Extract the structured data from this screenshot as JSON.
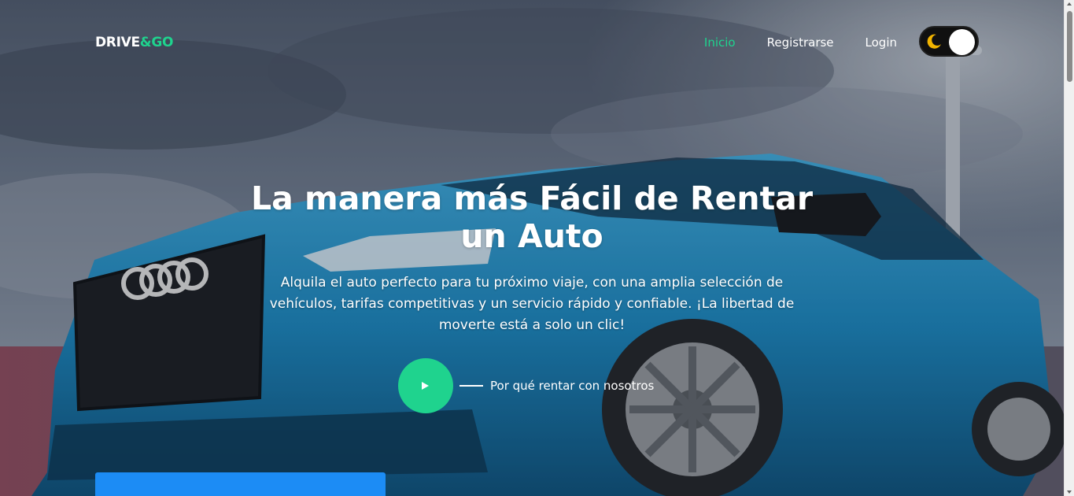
{
  "navbar": {
    "logo_main": "DRIVE",
    "logo_accent": "&GO",
    "links": [
      {
        "label": "Inicio",
        "active": true
      },
      {
        "label": "Registrarse",
        "active": false
      },
      {
        "label": "Login",
        "active": false
      }
    ],
    "theme_toggle": {
      "icon": "moon-icon",
      "mode": "dark"
    }
  },
  "hero": {
    "title": "La manera más Fácil de Rentar un Auto",
    "subtitle": "Alquila el auto perfecto para tu próximo viaje, con una amplia selección de vehículos, tarifas competitivas y un servicio rápido y confiable. ¡La libertad de moverte está a solo un clic!",
    "cta_label": "Por qué rentar con nosotros",
    "play_icon": "play-icon",
    "background": "blue-car-hero-image"
  },
  "colors": {
    "accent": "#1fd38e",
    "panel_blue": "#1c8cf5",
    "toggle_bg": "#101010",
    "moon": "#f2b400"
  }
}
